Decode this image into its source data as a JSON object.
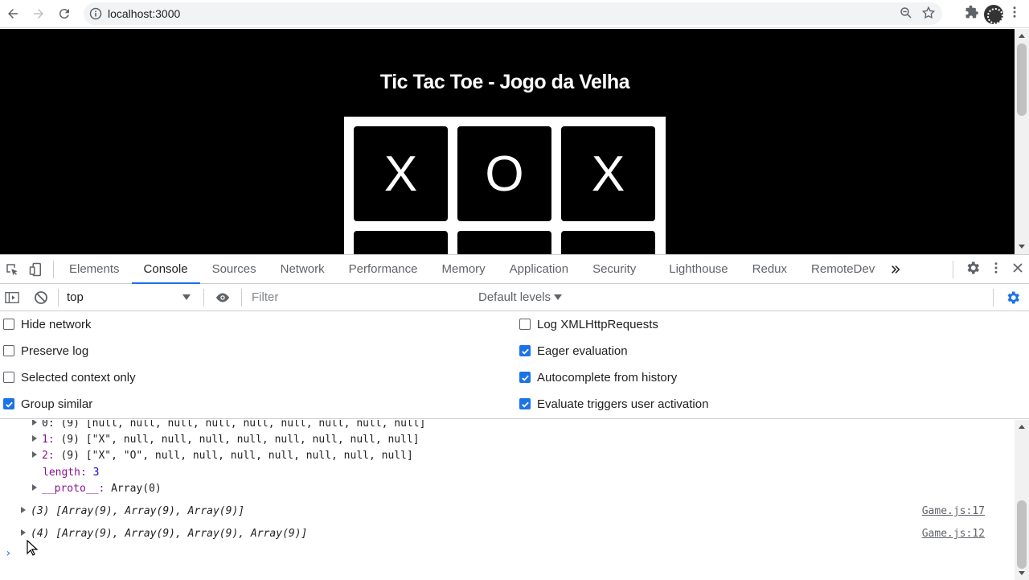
{
  "browser": {
    "url": "localhost:3000"
  },
  "page": {
    "title": "Tic Tac Toe - Jogo da Velha",
    "board": [
      "X",
      "O",
      "X",
      "",
      "",
      ""
    ]
  },
  "devtools": {
    "tabs": [
      "Elements",
      "Console",
      "Sources",
      "Network",
      "Performance",
      "Memory",
      "Application",
      "Security",
      "Lighthouse",
      "Redux",
      "RemoteDev"
    ],
    "active_tab": "Console",
    "context": "top",
    "filter_placeholder": "Filter",
    "levels": "Default levels",
    "settings_left": [
      {
        "label": "Hide network",
        "checked": false
      },
      {
        "label": "Preserve log",
        "checked": false
      },
      {
        "label": "Selected context only",
        "checked": false
      },
      {
        "label": "Group similar",
        "checked": true
      }
    ],
    "settings_right": [
      {
        "label": "Log XMLHttpRequests",
        "checked": false
      },
      {
        "label": "Eager evaluation",
        "checked": true
      },
      {
        "label": "Autocomplete from history",
        "checked": true
      },
      {
        "label": "Evaluate triggers user activation",
        "checked": true
      }
    ],
    "console": {
      "row0": "0: (9) [null, null, null, null, null, null, null, null, null]",
      "row1_key": "1:",
      "row1_val": " (9) [\"X\", null, null, null, null, null, null, null, null]",
      "row2_key": "2:",
      "row2_val": " (9) [\"X\", \"O\", null, null, null, null, null, null, null]",
      "length_key": "length:",
      "length_val": " 3",
      "proto_key": "__proto__:",
      "proto_val": " Array(0)",
      "log1": "(3) [Array(9), Array(9), Array(9)]",
      "log1_src": "Game.js:17",
      "log2": "(4) [Array(9), Array(9), Array(9), Array(9)]",
      "log2_src": "Game.js:12",
      "prompt": "›"
    }
  }
}
